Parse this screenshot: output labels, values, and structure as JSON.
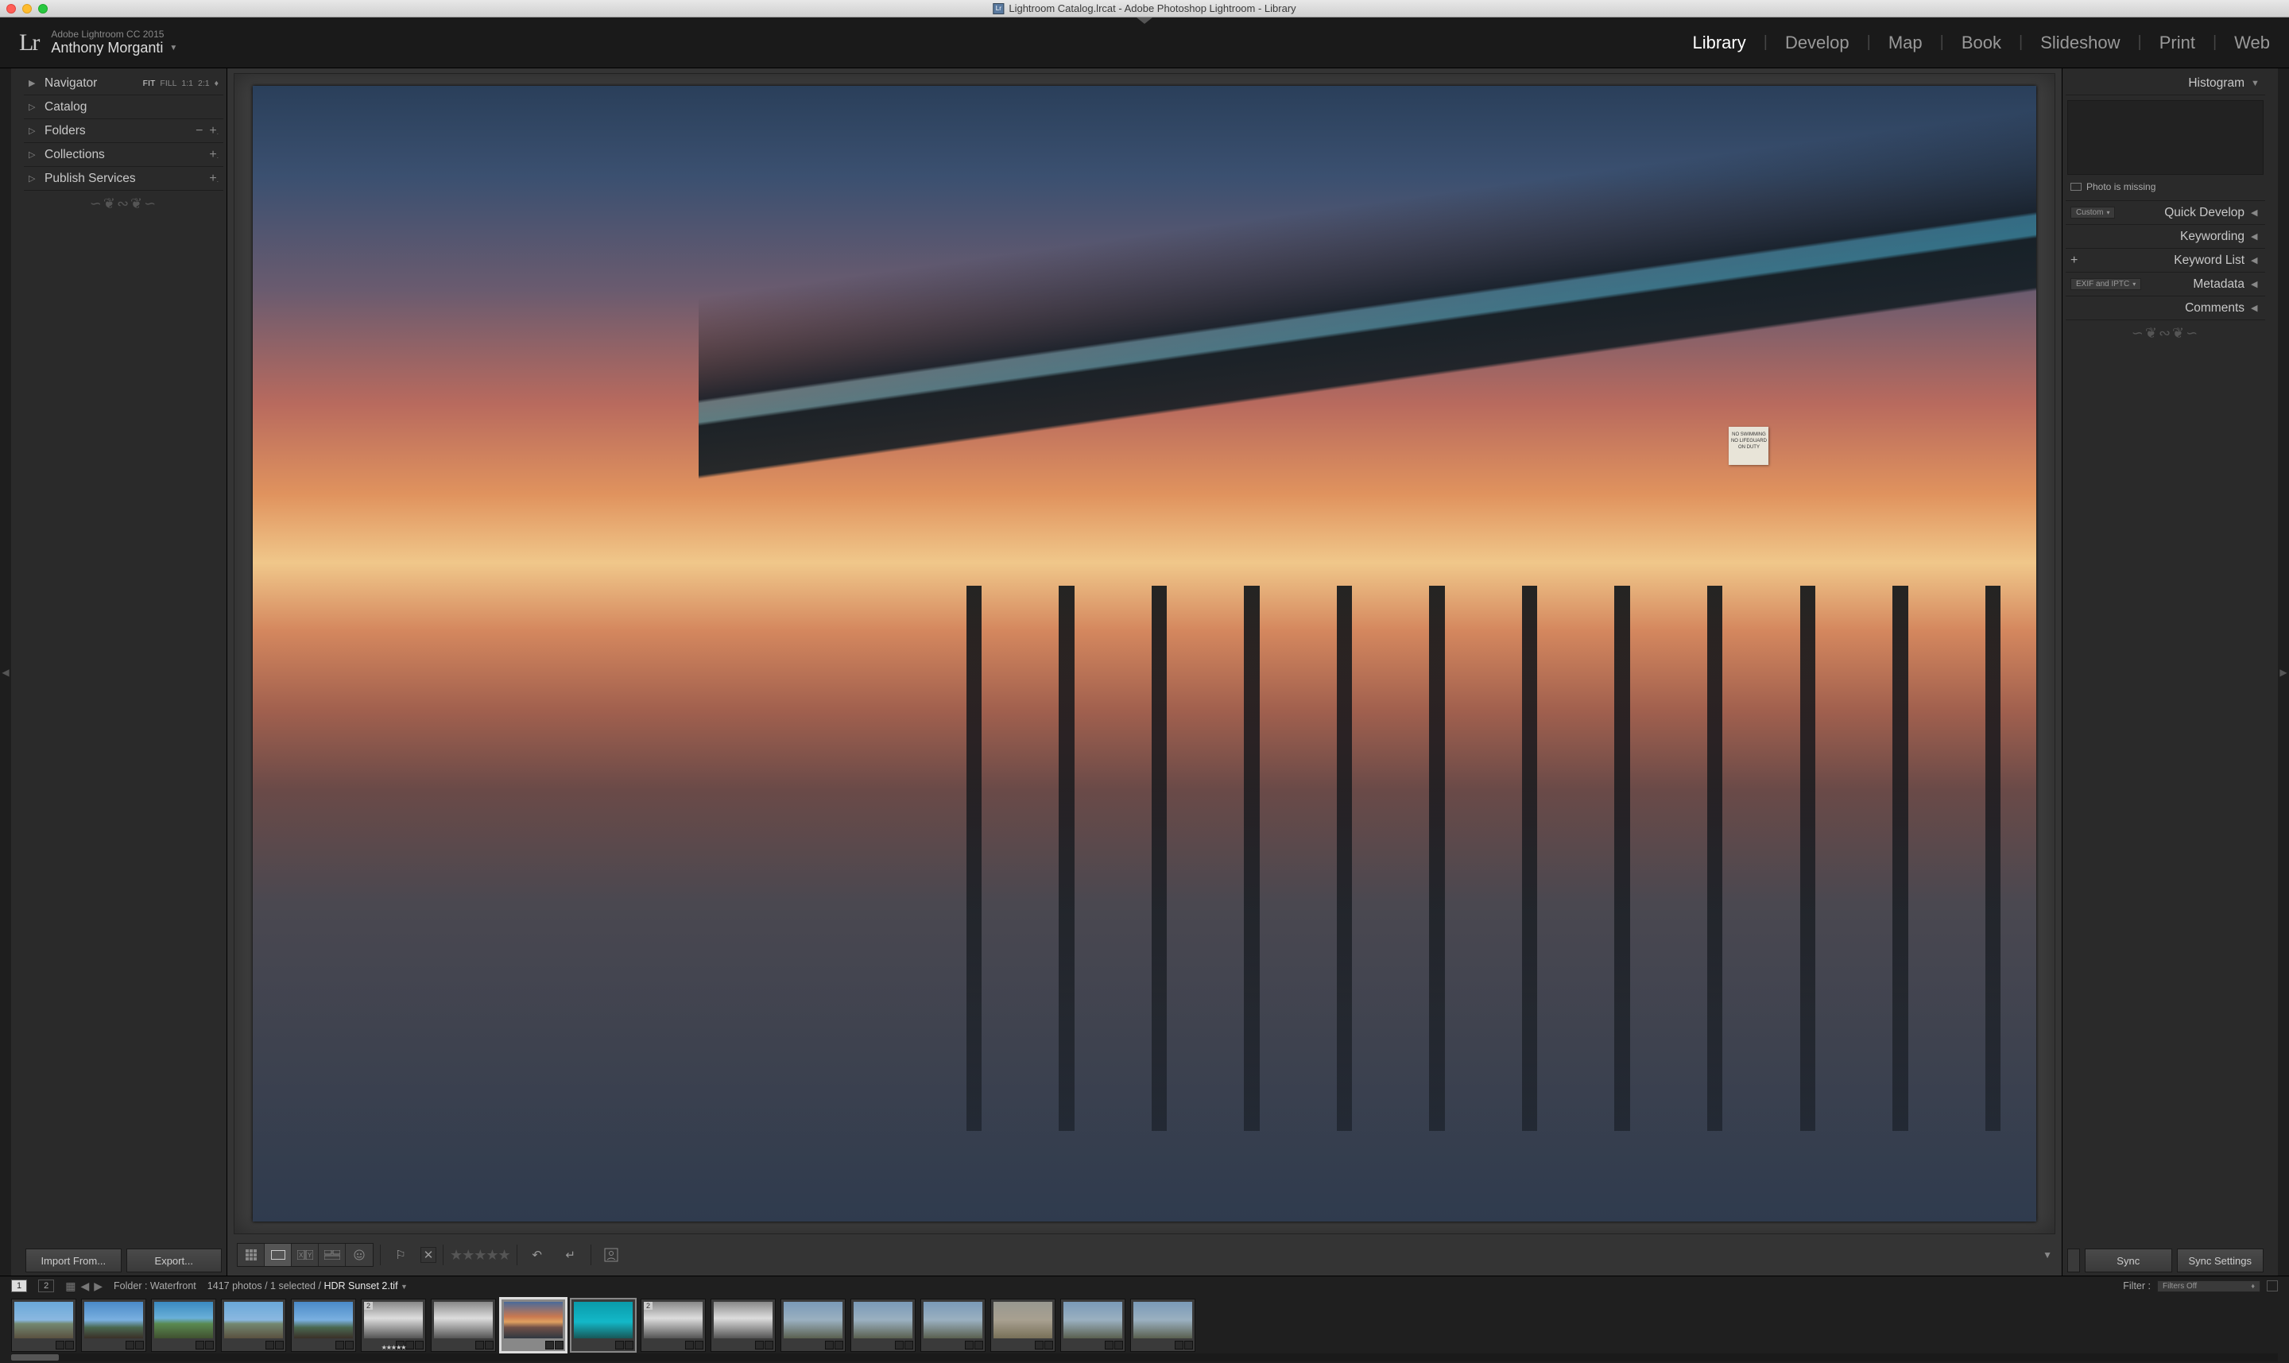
{
  "titlebar": {
    "title": "Lightroom Catalog.lrcat - Adobe Photoshop Lightroom - Library"
  },
  "header": {
    "product": "Adobe Lightroom CC 2015",
    "user": "Anthony Morganti",
    "modules": [
      "Library",
      "Develop",
      "Map",
      "Book",
      "Slideshow",
      "Print",
      "Web"
    ],
    "active_module": "Library"
  },
  "left_panels": {
    "navigator": {
      "label": "Navigator",
      "modes": [
        "FIT",
        "FILL",
        "1:1",
        "2:1"
      ],
      "active_mode": "FIT"
    },
    "catalog": "Catalog",
    "folders": "Folders",
    "collections": "Collections",
    "publish": "Publish Services"
  },
  "left_buttons": {
    "import": "Import From...",
    "export": "Export..."
  },
  "right_panels": {
    "histogram": "Histogram",
    "missing": "Photo is missing",
    "quick_develop": "Quick Develop",
    "quick_develop_preset": "Custom",
    "keywording": "Keywording",
    "keyword_list": "Keyword List",
    "metadata": "Metadata",
    "metadata_preset": "EXIF and IPTC",
    "comments": "Comments"
  },
  "right_buttons": {
    "sync": "Sync",
    "sync_settings": "Sync Settings"
  },
  "sign_text": "NO SWIMMING\nNO LIFEGUARD\nON DUTY",
  "filmstrip": {
    "view_num_a": "1",
    "view_num_b": "2",
    "source": "Folder : Waterfront",
    "count": "1417 photos / 1 selected /",
    "current": "HDR Sunset 2.tif",
    "filter_label": "Filter :",
    "filter_value": "Filters Off"
  }
}
